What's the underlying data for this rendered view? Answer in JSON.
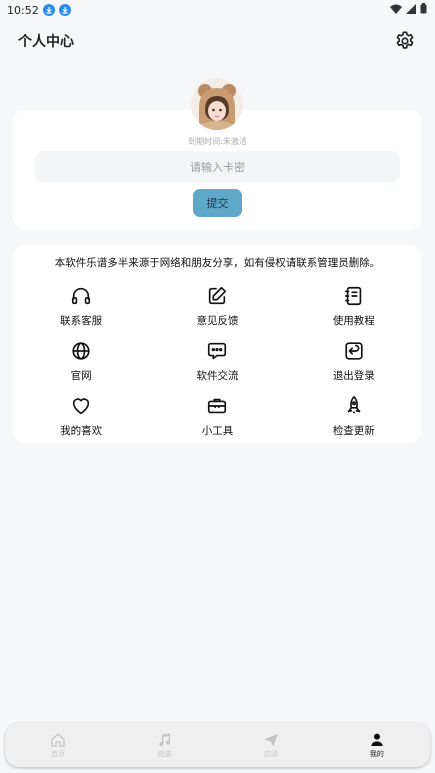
{
  "status": {
    "time": "10:52"
  },
  "header": {
    "title": "个人中心"
  },
  "profile": {
    "expire_text": "到期时间:未激活",
    "key_placeholder": "请输入卡密",
    "submit_label": "提交"
  },
  "menu": {
    "notice": "本软件乐谱多半来源于网络和朋友分享，如有侵权请联系管理员删除。",
    "items": [
      {
        "label": "联系客服",
        "icon": "headphones-icon"
      },
      {
        "label": "意见反馈",
        "icon": "edit-icon"
      },
      {
        "label": "使用教程",
        "icon": "notebook-icon"
      },
      {
        "label": "官网",
        "icon": "globe-icon"
      },
      {
        "label": "软件交流",
        "icon": "chat-icon"
      },
      {
        "label": "退出登录",
        "icon": "logout-icon"
      },
      {
        "label": "我的喜欢",
        "icon": "heart-icon"
      },
      {
        "label": "小工具",
        "icon": "toolbox-icon"
      },
      {
        "label": "检查更新",
        "icon": "rocket-icon"
      }
    ]
  },
  "tabbar": {
    "tabs": [
      {
        "label": "首页",
        "icon": "home-icon"
      },
      {
        "label": "曲谱",
        "icon": "music-icon"
      },
      {
        "label": "启动",
        "icon": "send-icon"
      },
      {
        "label": "我的",
        "icon": "user-icon"
      }
    ],
    "active_index": 3
  },
  "colors": {
    "accent": "#5fa8c9",
    "download_badge": "#2a8cf0"
  }
}
